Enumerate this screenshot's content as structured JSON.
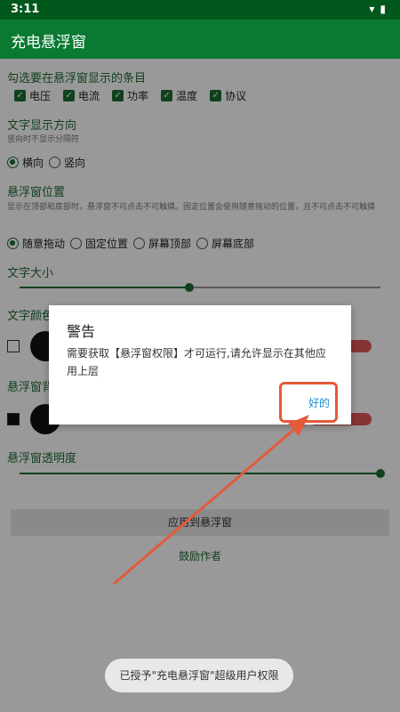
{
  "status": {
    "time": "3:11",
    "icons": [
      "wifi-icon",
      "battery-icon"
    ]
  },
  "appbar": {
    "title": "充电悬浮窗"
  },
  "items_section": {
    "title": "勾选要在悬浮窗显示的条目",
    "items": [
      "电压",
      "电流",
      "功率",
      "温度",
      "协议"
    ]
  },
  "direction_section": {
    "title": "文字显示方向",
    "hint": "竖向时不显示分隔符",
    "options": [
      "横向",
      "竖向"
    ],
    "selected": 0
  },
  "position_section": {
    "title": "悬浮窗位置",
    "hint": "显示在顶部和底部时，悬浮窗不可点击不可触摸。固定位置会使用随意拖动的位置，且不可点击不可触摸",
    "options": [
      "随意拖动",
      "固定位置",
      "屏幕顶部",
      "屏幕底部"
    ],
    "selected": 0
  },
  "text_size_section": {
    "title": "文字大小",
    "value_fraction": 0.47
  },
  "text_color_section": {
    "title": "文字颜色"
  },
  "bg_color_section": {
    "title": "悬浮窗背景颜色"
  },
  "opacity_section": {
    "title": "悬浮窗透明度",
    "value_fraction": 1.0
  },
  "apply_button": "应用到悬浮窗",
  "encourage_link": "鼓励作者",
  "dialog": {
    "title": "警告",
    "message": "需要获取【悬浮窗权限】才可运行,请允许显示在其他应用上层",
    "ok_button": "好的"
  },
  "toast": "已授予\"充电悬浮窗\"超级用户权限",
  "colors": {
    "primary": "#0a7a32",
    "status_bar": "#00581c",
    "accent_link": "#1a8fd2",
    "annotation": "#e35a3a"
  }
}
